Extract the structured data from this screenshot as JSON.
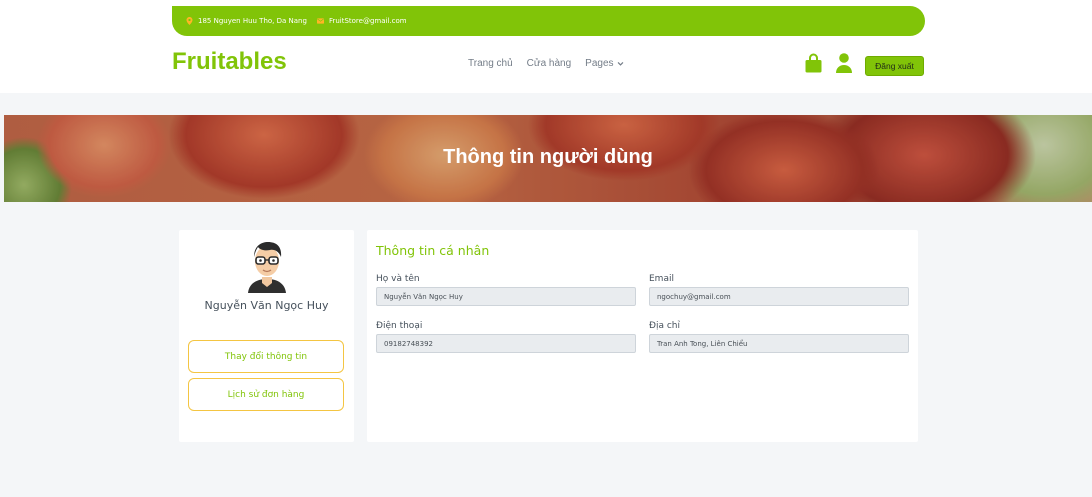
{
  "topbar": {
    "address": "185 Nguyen Huu Tho, Da Nang",
    "email": "FruitStore@gmail.com"
  },
  "header": {
    "brand": "Fruitables",
    "nav": [
      "Trang chủ",
      "Cửa hàng",
      "Pages"
    ],
    "logout_label": "Đăng xuất"
  },
  "banner": {
    "title": "Thông tin người dùng"
  },
  "profile": {
    "name": "Nguyễn Văn Ngọc Huy",
    "edit_label": "Thay đổi thông tin",
    "orders_label": "Lịch sử đơn hàng"
  },
  "info": {
    "title": "Thông tin cá nhân",
    "fullname_label": "Họ và tên",
    "fullname_value": "Nguyễn Văn Ngọc Huy",
    "email_label": "Email",
    "email_value": "ngochuy@gmail.com",
    "phone_label": "Điện thoại",
    "phone_value": "09182748392",
    "address_label": "Địa chỉ",
    "address_value": "Tran Anh Tong, Liên Chiểu"
  },
  "colors": {
    "brand": "#81c408",
    "accent_yellow": "#ffb524"
  },
  "icons": [
    "map-marker-icon",
    "envelope-icon",
    "chevron-down-icon",
    "shopping-bag-icon",
    "user-icon"
  ]
}
